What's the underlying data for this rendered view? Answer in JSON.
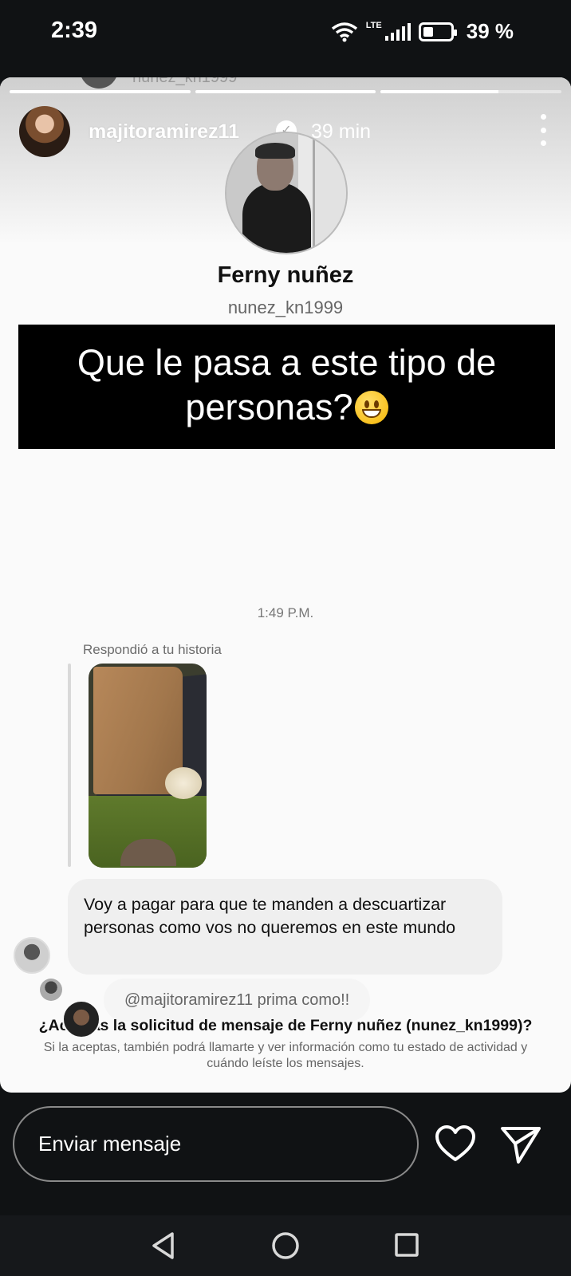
{
  "status_bar": {
    "time": "2:39",
    "network": "LTE",
    "battery": "39 %"
  },
  "story": {
    "previous_username": "nunez_kn1999",
    "progress": [
      1.0,
      1.0,
      0.65
    ],
    "author": {
      "username": "majitoramirez11",
      "posted_ago": "39 min",
      "verified": true
    },
    "overlay_text_line1": "Que le pasa a este tipo de",
    "overlay_text_line2": "personas?"
  },
  "dm_screenshot": {
    "profile_name": "Ferny nuñez",
    "profile_handle": "nunez_kn1999",
    "message_time": "1:49 P.M.",
    "replied_label": "Respondió a tu historia",
    "message_text": "Voy a pagar para que te manden a descuartizar personas como vos no queremos en este mundo",
    "reply_mention": "@majitoramirez11 prima como!!",
    "request_title": "¿Aceptas la solicitud de mensaje de Ferny nuñez (nunez_kn1999)?",
    "request_subtitle": "Si la aceptas, también podrá llamarte y ver información como tu estado de actividad y cuándo leíste los mensajes."
  },
  "message_bar": {
    "placeholder": "Enviar mensaje",
    "like_icon": "heart-icon",
    "send_icon": "send-icon"
  },
  "nav": {
    "back_icon": "back-triangle-icon",
    "home_icon": "home-circle-icon",
    "recents_icon": "recents-square-icon"
  }
}
